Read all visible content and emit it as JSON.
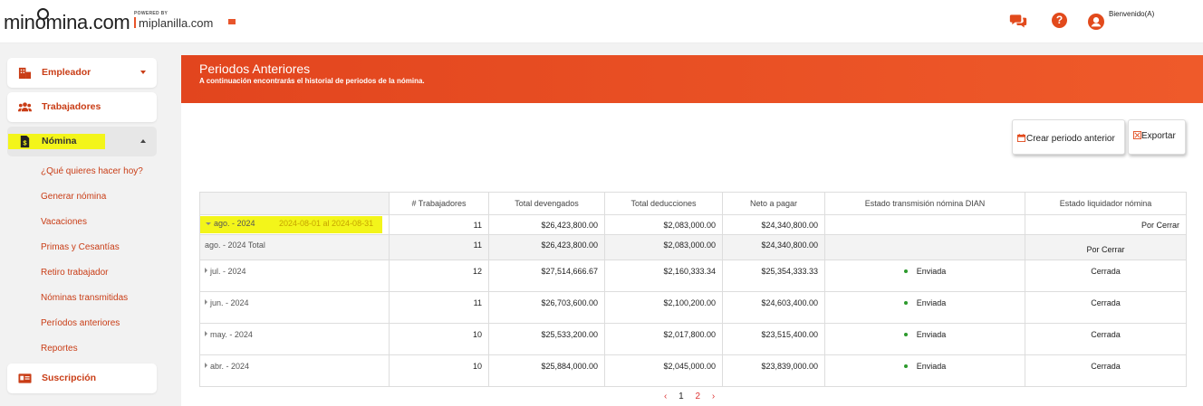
{
  "brand": {
    "logo_text": "minómina.com",
    "logo_before": "min",
    "logo_mark": "o",
    "logo_after": "mina.com",
    "powered_by": "POWERED BY",
    "partner": "miplanilla.com"
  },
  "header": {
    "welcome": "Bienvenido(A)",
    "icons": [
      "chat-icon",
      "help-icon",
      "user-icon"
    ],
    "help_glyph": "?"
  },
  "sidebar": {
    "items": [
      {
        "label": "Empleador",
        "icon": "building-icon"
      },
      {
        "label": "Trabajadores",
        "icon": "users-icon"
      },
      {
        "label": "Nómina",
        "icon": "payroll-icon"
      },
      {
        "label": "Suscripción",
        "icon": "id-card-icon"
      }
    ],
    "subitems": [
      {
        "label": "¿Qué quieres hacer hoy?"
      },
      {
        "label": "Generar nómina"
      },
      {
        "label": "Vacaciones"
      },
      {
        "label": "Primas y Cesantías"
      },
      {
        "label": "Retiro trabajador"
      },
      {
        "label": "Nóminas transmitidas"
      },
      {
        "label": "Períodos anteriores"
      },
      {
        "label": "Reportes"
      }
    ]
  },
  "page": {
    "title": "Periodos Anteriores",
    "subtitle": "A continuación encontrarás el historial de periodos de la nómina.",
    "btn_crear": "Crear periodo anterior",
    "btn_exportar": "Exportar"
  },
  "table": {
    "headers": [
      "",
      "# Trabajadores",
      "Total devengados",
      "Total deducciones",
      "Neto a pagar",
      "Estado transmisión nómina DIAN",
      "Estado liquidador nómina"
    ],
    "aug": {
      "period": "ago. - 2024",
      "range": "2024-08-01 al 2024-08-31",
      "workers": "11",
      "devengados": "$26,423,800.00",
      "deducciones": "$2,083,000.00",
      "neto": "$24,340,800.00",
      "dian": "",
      "liquidador": "Por Cerrar"
    },
    "total": {
      "period": "ago. - 2024 Total",
      "workers": "11",
      "devengados": "$26,423,800.00",
      "deducciones": "$2,083,000.00",
      "neto": "$24,340,800.00",
      "dian": "",
      "liquidador": "Por Cerrar"
    },
    "rows": [
      {
        "period": "jul. - 2024",
        "workers": "12",
        "devengados": "$27,514,666.67",
        "deducciones": "$2,160,333.34",
        "neto": "$25,354,333.33",
        "dian": "Enviada",
        "liquidador": "Cerrada"
      },
      {
        "period": "jun. - 2024",
        "workers": "11",
        "devengados": "$26,703,600.00",
        "deducciones": "$2,100,200.00",
        "neto": "$24,603,400.00",
        "dian": "Enviada",
        "liquidador": "Cerrada"
      },
      {
        "period": "may. - 2024",
        "workers": "10",
        "devengados": "$25,533,200.00",
        "deducciones": "$2,017,800.00",
        "neto": "$23,515,400.00",
        "dian": "Enviada",
        "liquidador": "Cerrada"
      },
      {
        "period": "abr. - 2024",
        "workers": "10",
        "devengados": "$25,884,000.00",
        "deducciones": "$2,045,000.00",
        "neto": "$23,839,000.00",
        "dian": "Enviada",
        "liquidador": "Cerrada"
      }
    ]
  },
  "pagination": {
    "prev": "‹",
    "pages": [
      "1",
      "2"
    ],
    "next": "›"
  },
  "colors": {
    "accent": "#e8552b",
    "banner": "#e2451e",
    "highlight": "#f3f51a",
    "success": "#2c9a2c",
    "danger": "#dd3333"
  }
}
